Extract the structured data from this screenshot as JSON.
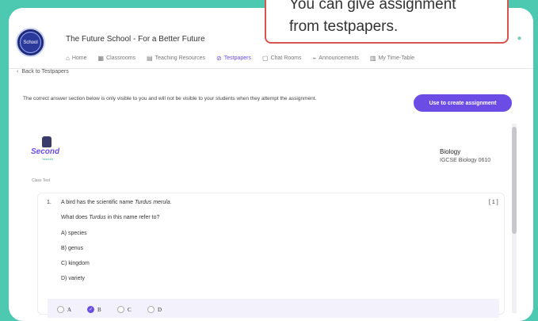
{
  "header": {
    "logo_text": "School",
    "school_name": "The Future School - For a Better Future",
    "nav": [
      {
        "label": "Home",
        "icon": "home-icon",
        "glyph": "⌂"
      },
      {
        "label": "Classrooms",
        "icon": "classroom-icon",
        "glyph": "▦"
      },
      {
        "label": "Teaching Resources",
        "icon": "book-icon",
        "glyph": "▤"
      },
      {
        "label": "Testpapers",
        "icon": "testpaper-icon",
        "glyph": "⊘"
      },
      {
        "label": "Chat Rooms",
        "icon": "chat-icon",
        "glyph": "▢"
      },
      {
        "label": "Announcements",
        "icon": "megaphone-icon",
        "glyph": "⌁"
      },
      {
        "label": "My Time-Table",
        "icon": "calendar-icon",
        "glyph": "▥"
      }
    ]
  },
  "page": {
    "back_label": "Back to Testpapers",
    "notice": "The correct answer section below is only visible to you and will not be visible to your students when they attempt the assignment.",
    "cta_label": "Use to create assignment"
  },
  "paper": {
    "brand_word": "Second",
    "brand_sub": "Teacher",
    "subject": "Biology",
    "syllabus": "IGCSE Biology 0610",
    "class_label": "Class Test"
  },
  "question": {
    "number": "1.",
    "text_prefix": "A bird has the scientific name ",
    "text_italic": "Turdus merula",
    "text_suffix": ".",
    "sub_prefix": "What does ",
    "sub_italic": "Turdus",
    "sub_suffix": " in this name refer to?",
    "marks": "[ 1 ]",
    "options": [
      "A) species",
      "B) genus",
      "C) kingdom",
      "D) variety"
    ],
    "answers": [
      "A",
      "B",
      "C",
      "D"
    ],
    "selected": "B"
  },
  "callout": {
    "text": "You can give assignment\nfrom testpapers."
  }
}
